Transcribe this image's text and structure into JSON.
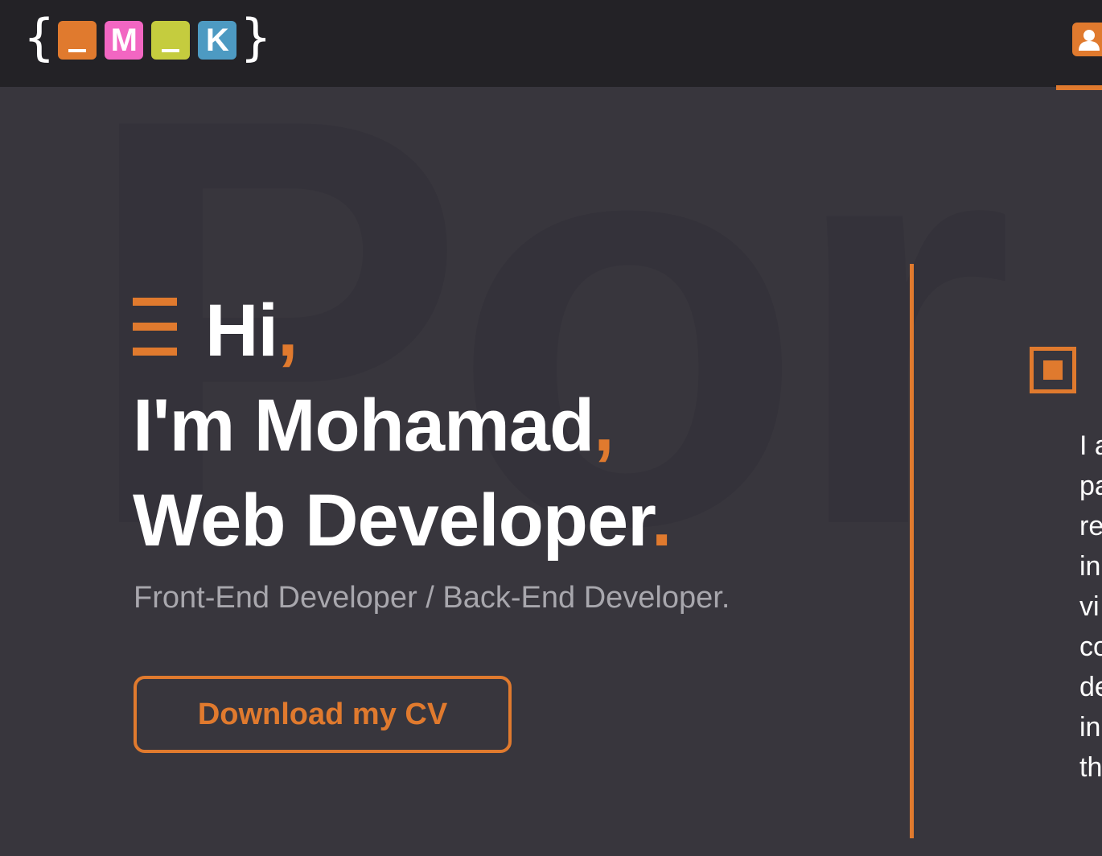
{
  "header": {
    "logo": {
      "brace_open": "{",
      "brace_close": "}",
      "boxes": [
        {
          "char": "_",
          "color": "#e07a2e"
        },
        {
          "char": "M",
          "color": "#f266c2"
        },
        {
          "char": "_",
          "color": "#c5cc3e"
        },
        {
          "char": "K",
          "color": "#4d9ac2"
        }
      ]
    },
    "user_icon": "user-icon"
  },
  "background_word": "Por",
  "hero": {
    "menu_icon": "menu-icon",
    "line1": "Hi",
    "line1_punct": ",",
    "line2": "I'm Mohamad",
    "line2_punct": ",",
    "line3": "Web Developer",
    "line3_punct": ".",
    "subtitle": "Front-End Developer / Back-End Developer.",
    "cv_button": "Download my CV"
  },
  "about": {
    "icon": "square-icon",
    "visible_line_fragments": [
      "I a",
      "pa",
      "re",
      "in",
      "vi",
      "co",
      "de",
      "in",
      "th"
    ]
  },
  "colors": {
    "accent": "#e07a2e",
    "background": "#38363d",
    "topbar": "#232226"
  }
}
